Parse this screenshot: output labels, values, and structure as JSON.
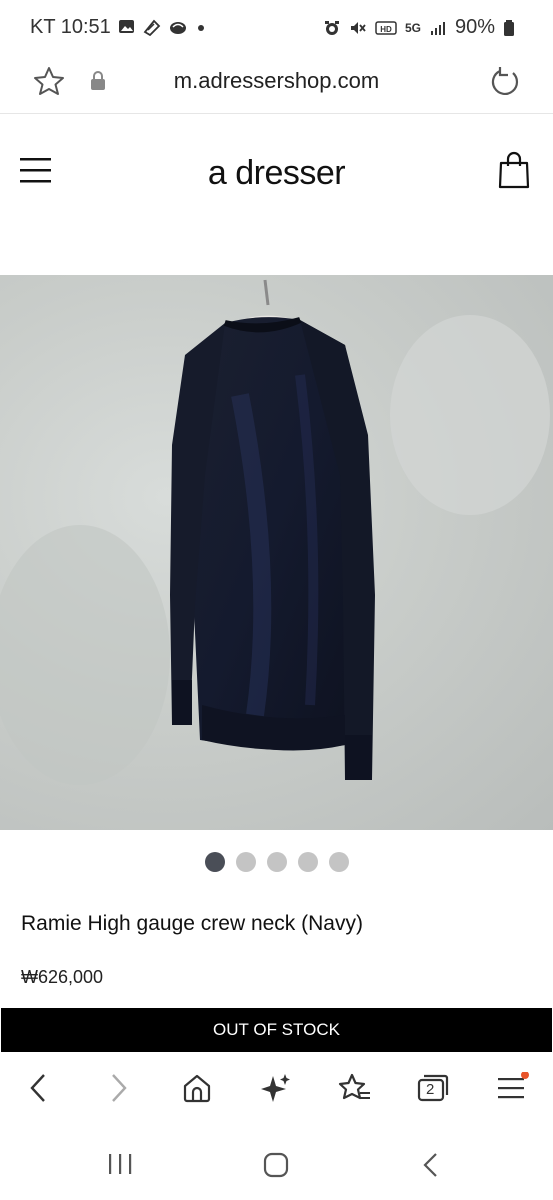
{
  "status_bar": {
    "carrier_time": "KT 10:51",
    "network": "5G",
    "battery": "90%"
  },
  "browser": {
    "url": "m.adressershop.com"
  },
  "site": {
    "brand": "a dresser"
  },
  "product": {
    "image_count": 5,
    "active_image": 1,
    "name": "Ramie High gauge crew neck (Navy)",
    "price": "₩626,000",
    "stock_button_label": "OUT OF STOCK"
  },
  "toolbar": {
    "tabs_count": "2",
    "accent": "#e8542a"
  }
}
